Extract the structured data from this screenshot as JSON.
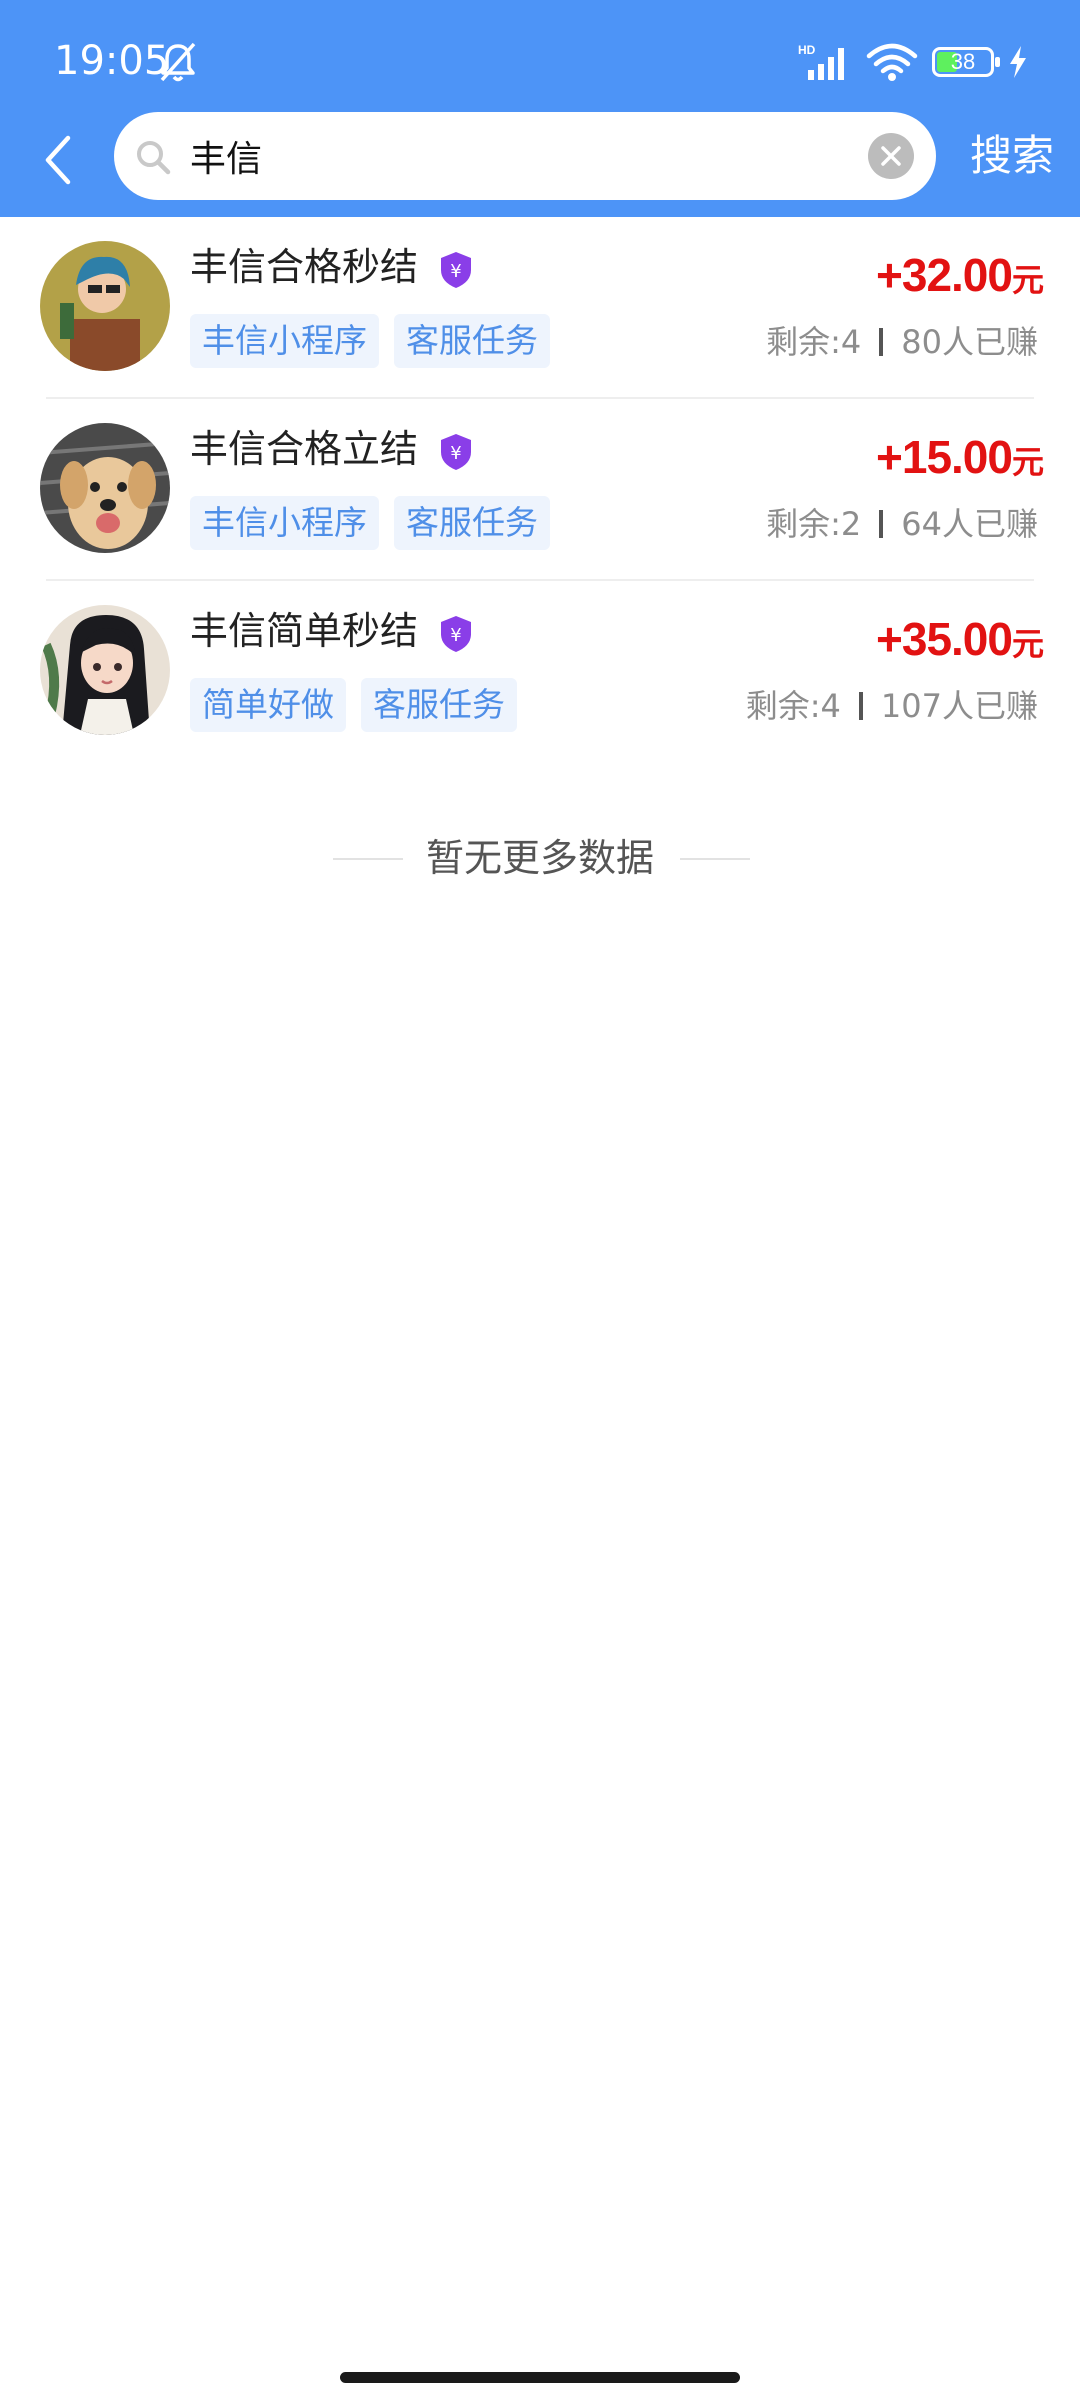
{
  "status_bar": {
    "time": "19:05",
    "battery": "38",
    "icons": [
      "bell-off-icon",
      "hd-signal-icon",
      "wifi-icon",
      "battery-icon",
      "charging-icon"
    ]
  },
  "nav": {
    "back_icon": "chevron-left-icon",
    "search_value": "丰信",
    "search_button": "搜索"
  },
  "results": [
    {
      "title": "丰信合格秒结",
      "tags": [
        "丰信小程序",
        "客服任务"
      ],
      "price": "+32.00",
      "unit": "元",
      "remaining": "剩余:4",
      "earned": "80人已赚",
      "avatar": "illustrated-woman-avatar"
    },
    {
      "title": "丰信合格立结",
      "tags": [
        "丰信小程序",
        "客服任务"
      ],
      "price": "+15.00",
      "unit": "元",
      "remaining": "剩余:2",
      "earned": "64人已赚",
      "avatar": "golden-retriever-avatar"
    },
    {
      "title": "丰信简单秒结",
      "tags": [
        "简单好做",
        "客服任务"
      ],
      "price": "+35.00",
      "unit": "元",
      "remaining": "剩余:4",
      "earned": "107人已赚",
      "avatar": "anime-girl-avatar"
    }
  ],
  "footer_text": "暂无更多数据",
  "colors": {
    "accent": "#4d94f7",
    "price": "#e21212",
    "tag_text": "#4f8fe8",
    "tag_bg": "#eef4fd",
    "badge": "#8a3ee8"
  }
}
